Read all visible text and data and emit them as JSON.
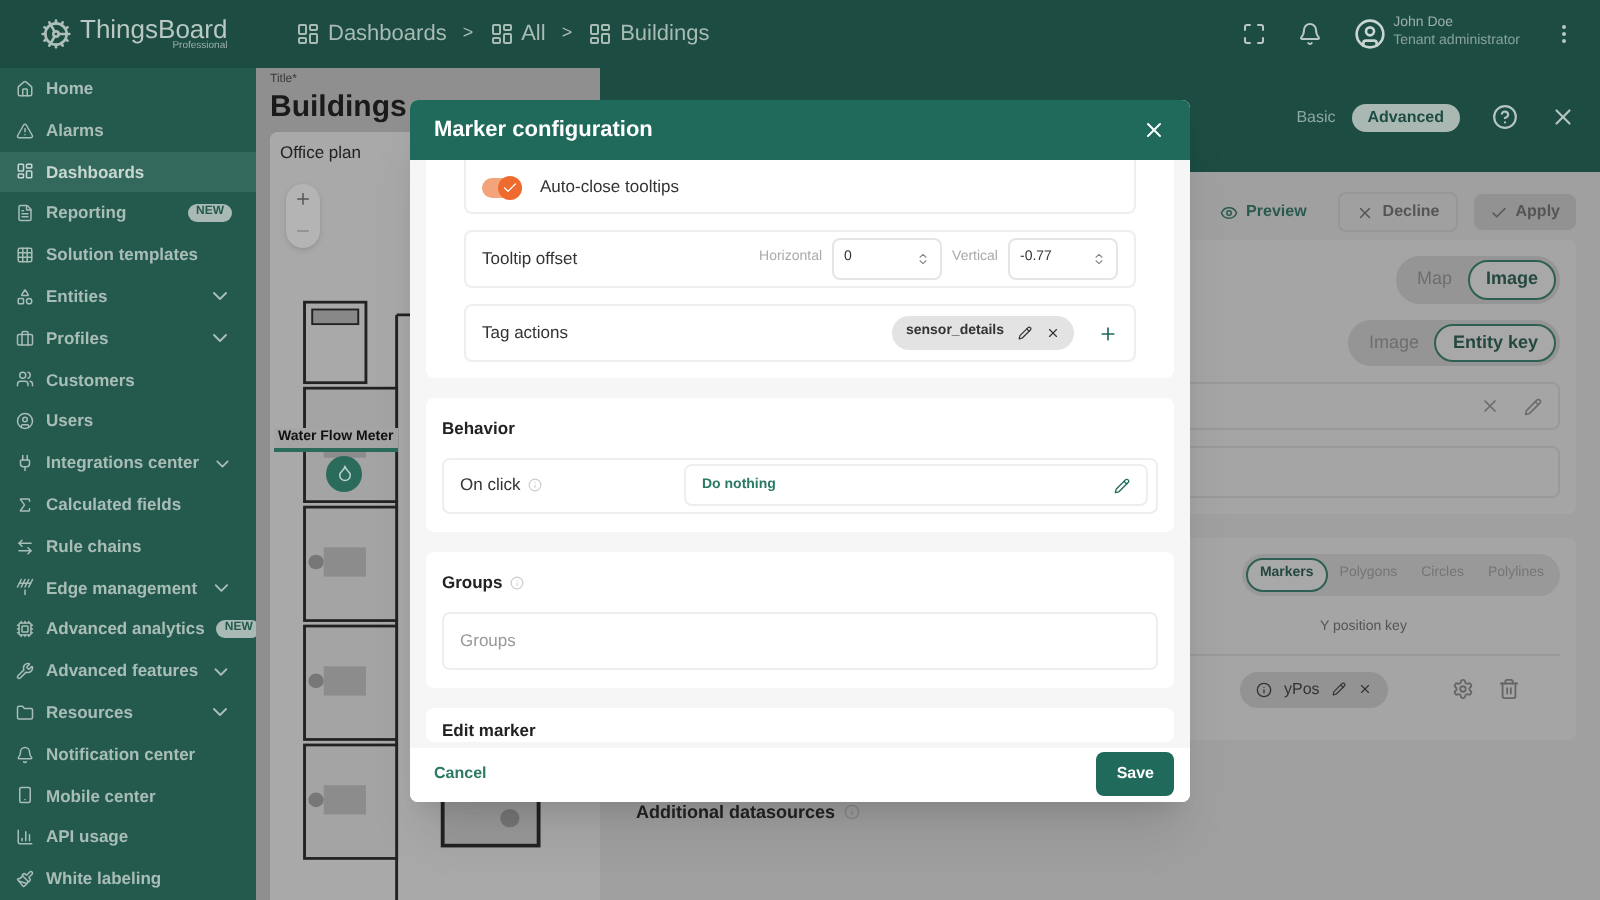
{
  "app": {
    "name": "ThingsBoard",
    "edition": "Professional"
  },
  "breadcrumbs": [
    {
      "label": "Dashboards",
      "separator": ">"
    },
    {
      "label": "All",
      "separator": ">"
    },
    {
      "label": "Buildings"
    }
  ],
  "user": {
    "name": "John Doe",
    "role": "Tenant administrator"
  },
  "sidebar": {
    "items": [
      {
        "label": "Home",
        "selected": false
      },
      {
        "label": "Alarms",
        "selected": false
      },
      {
        "label": "Dashboards",
        "selected": true
      },
      {
        "label": "Reporting",
        "selected": false,
        "badge": "NEW"
      },
      {
        "label": "Solution templates",
        "selected": false
      },
      {
        "label": "Entities",
        "selected": false,
        "expandable": true
      },
      {
        "label": "Profiles",
        "selected": false,
        "expandable": true
      },
      {
        "label": "Customers",
        "selected": false
      },
      {
        "label": "Users",
        "selected": false
      },
      {
        "label": "Integrations center",
        "selected": false,
        "expandable": true
      },
      {
        "label": "Calculated fields",
        "selected": false
      },
      {
        "label": "Rule chains",
        "selected": false
      },
      {
        "label": "Edge management",
        "selected": false,
        "expandable": true
      },
      {
        "label": "Advanced analytics",
        "selected": false,
        "badge": "NEW"
      },
      {
        "label": "Advanced features",
        "selected": false,
        "expandable": true
      },
      {
        "label": "Resources",
        "selected": false,
        "expandable": true
      },
      {
        "label": "Notification center",
        "selected": false
      },
      {
        "label": "Mobile center",
        "selected": false
      },
      {
        "label": "API usage",
        "selected": false
      },
      {
        "label": "White labeling",
        "selected": false
      }
    ]
  },
  "dashboard": {
    "title_label": "Title*",
    "title": "Buildings",
    "widget_title": "Office plan",
    "marker_label": "Water Flow Meter"
  },
  "editor": {
    "modes": [
      {
        "label": "Basic",
        "selected": false
      },
      {
        "label": "Advanced",
        "selected": true
      }
    ],
    "actions": [
      {
        "label": "Preview",
        "kind": "preview",
        "disabled": false
      },
      {
        "label": "Decline",
        "kind": "decline",
        "disabled": true
      },
      {
        "label": "Apply",
        "kind": "apply",
        "disabled": true
      }
    ],
    "map_types": [
      {
        "label": "Map",
        "selected": false
      },
      {
        "label": "Image",
        "selected": true
      }
    ],
    "image_sources": [
      {
        "label": "Image",
        "selected": false
      },
      {
        "label": "Entity key",
        "selected": true
      }
    ],
    "layer_tabs": [
      {
        "label": "Markers",
        "selected": true
      },
      {
        "label": "Polygons",
        "selected": false
      },
      {
        "label": "Circles",
        "selected": false
      },
      {
        "label": "Polylines",
        "selected": false
      }
    ],
    "column_header": "Y position key",
    "y_key": "yPos",
    "additional_title": "Additional datasources"
  },
  "dialog": {
    "title": "Marker configuration",
    "auto_close": {
      "label": "Auto-close tooltips",
      "on": true
    },
    "tooltip_offset": {
      "label": "Tooltip offset",
      "horizontal_label": "Horizontal",
      "horizontal": "0",
      "vertical_label": "Vertical",
      "vertical": "-0.77"
    },
    "tag_actions": {
      "label": "Tag actions",
      "tags": [
        "sensor_details"
      ]
    },
    "behavior": {
      "title": "Behavior",
      "on_click_label": "On click",
      "on_click_value": "Do nothing"
    },
    "groups": {
      "title": "Groups",
      "placeholder": "Groups"
    },
    "edit_marker_title": "Edit marker",
    "cancel": "Cancel",
    "save": "Save"
  }
}
